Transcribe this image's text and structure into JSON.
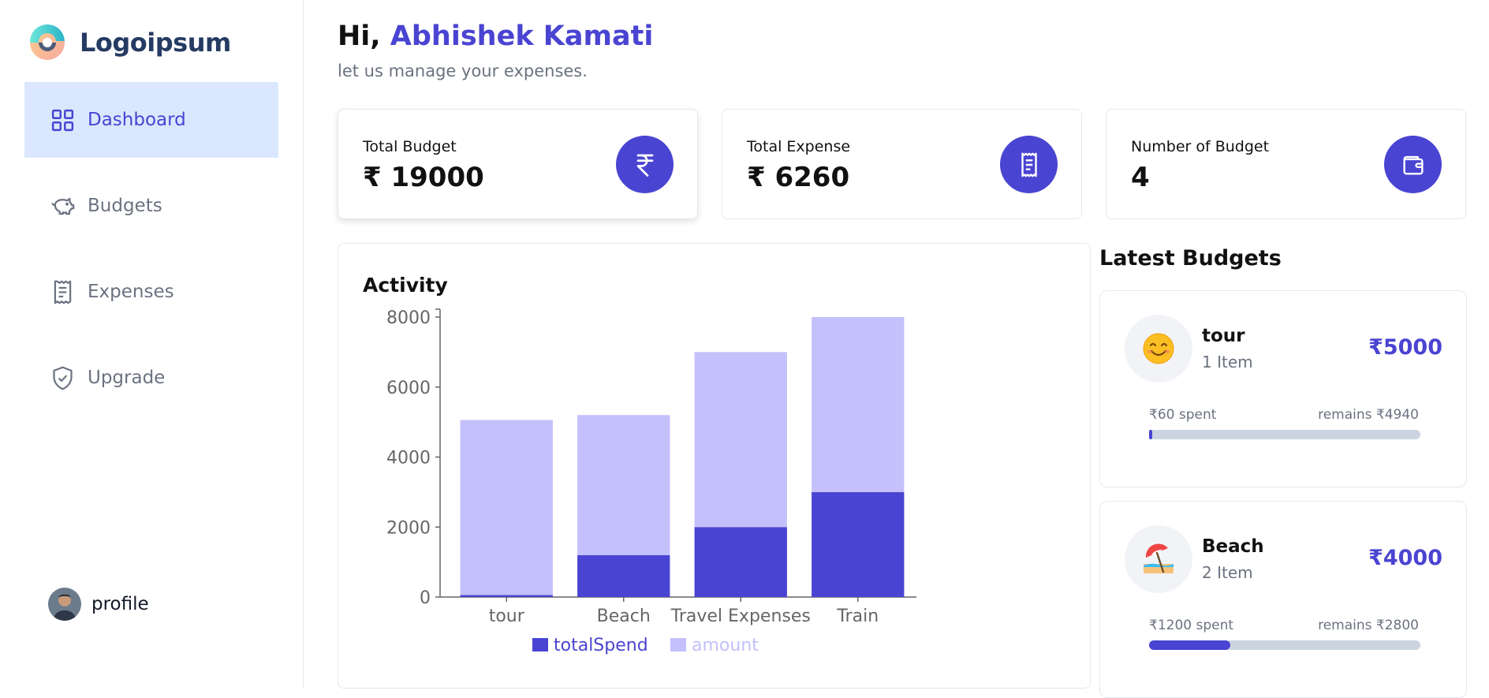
{
  "app": {
    "logo_text": "Logoipsum"
  },
  "sidebar": {
    "items": [
      {
        "label": "Dashboard",
        "icon": "grid-icon",
        "active": true
      },
      {
        "label": "Budgets",
        "icon": "piggy-bank-icon",
        "active": false
      },
      {
        "label": "Expenses",
        "icon": "receipt-icon",
        "active": false
      },
      {
        "label": "Upgrade",
        "icon": "shield-check-icon",
        "active": false
      }
    ],
    "profile_label": "profile"
  },
  "header": {
    "greeting": "Hi,",
    "user_name": "Abhishek Kamati",
    "subtitle": "let us manage your expenses."
  },
  "stats": [
    {
      "label": "Total Budget",
      "value": "₹ 19000",
      "icon": "rupee-icon"
    },
    {
      "label": "Total Expense",
      "value": "₹ 6260",
      "icon": "receipt-icon"
    },
    {
      "label": "Number of Budget",
      "value": "4",
      "icon": "wallet-icon"
    }
  ],
  "activity": {
    "title": "Activity"
  },
  "chart_data": {
    "type": "bar",
    "stacked": true,
    "categories": [
      "tour",
      "Beach",
      "Travel Expenses",
      "Train"
    ],
    "series": [
      {
        "name": "totalSpend",
        "values": [
          60,
          1200,
          2000,
          3000
        ],
        "color": "#4a44d2"
      },
      {
        "name": "amount",
        "values": [
          5000,
          4000,
          5000,
          5000
        ],
        "color": "#c3c0fb"
      }
    ],
    "y_ticks": [
      0,
      2000,
      4000,
      6000,
      8000
    ],
    "ylim": [
      0,
      8000
    ],
    "legend": "bottom-center",
    "grid": false
  },
  "latest": {
    "title": "Latest Budgets",
    "budgets": [
      {
        "emoji": "😊",
        "name": "tour",
        "items": "1 Item",
        "amount": "₹5000",
        "spent": "₹60 spent",
        "remains": "remains ₹4940",
        "progress": 0.012
      },
      {
        "emoji": "🏖",
        "name": "Beach",
        "items": "2 Item",
        "amount": "₹4000",
        "spent": "₹1200 spent",
        "remains": "remains ₹2800",
        "progress": 0.3
      }
    ]
  }
}
